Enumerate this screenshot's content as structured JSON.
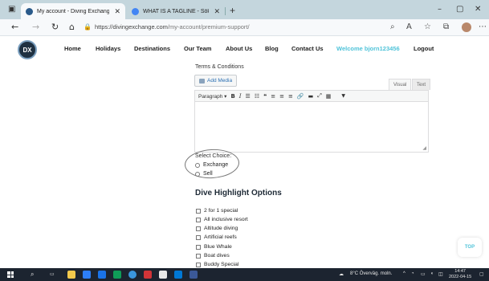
{
  "browser": {
    "tabs": [
      {
        "label": "My account - Diving Exchange",
        "favicon_color": "#2a5a8a",
        "close": "✕"
      },
      {
        "label": "WHAT IS A TAGLINE - Sök på Go",
        "favicon_color": "#4285f4",
        "close": "✕"
      }
    ],
    "new_tab": "+",
    "window_controls": {
      "minimize": "–",
      "maximize": "▢",
      "close": "✕"
    },
    "url_host": "https://divingexchange.com",
    "url_path": "/my-account/premium-support/",
    "nav_icons": {
      "back": "←",
      "forward": "→",
      "reload": "↻",
      "home": "⌂",
      "lock": "🔒"
    },
    "toolbar_icons": [
      "search-icon",
      "read-aloud-icon",
      "favorite-icon",
      "collections-icon",
      "profile-icon",
      "more-icon"
    ]
  },
  "site": {
    "logo_text": "DX",
    "menu": [
      "Home",
      "Holidays",
      "Destinations",
      "Our Team",
      "About Us",
      "Blog",
      "Contact Us"
    ],
    "welcome": "Welcome bjorn123456",
    "logout": "Logout"
  },
  "form": {
    "terms_label": "Terms & Conditions",
    "add_media": "Add Media",
    "mode_visual": "Visual",
    "mode_text": "Text",
    "format_select": "Paragraph",
    "toolbar_icons": [
      "bold-icon",
      "italic-icon",
      "bullet-list-icon",
      "numbered-list-icon",
      "blockquote-icon",
      "align-left-icon",
      "align-center-icon",
      "align-right-icon",
      "link-icon",
      "horizontal-rule-icon",
      "fullscreen-icon",
      "toolbar-toggle-icon",
      "dropdown-icon"
    ],
    "select_choice_label": "Select Choice:",
    "choices": [
      "Exchange",
      "Sell"
    ],
    "dive_highlight_title": "Dive Highlight Options",
    "dive_options": [
      "2 for 1 special",
      "All inclusive resort",
      "Altitude diving",
      "Artificial reefs",
      "Blue Whale",
      "Boat dives",
      "Buddy Special"
    ]
  },
  "top_button": "TOP",
  "taskbar": {
    "weather": "8°C  Överväg. moln.",
    "time": "14:47",
    "date": "2022-04-15",
    "app_colors": [
      "#f2c94c",
      "#2d7ff9",
      "#1a73e8",
      "#0f9d58",
      "#d13438",
      "#0078d4",
      "#e8e8e8",
      "#3a96dd",
      "#3b5998"
    ]
  }
}
